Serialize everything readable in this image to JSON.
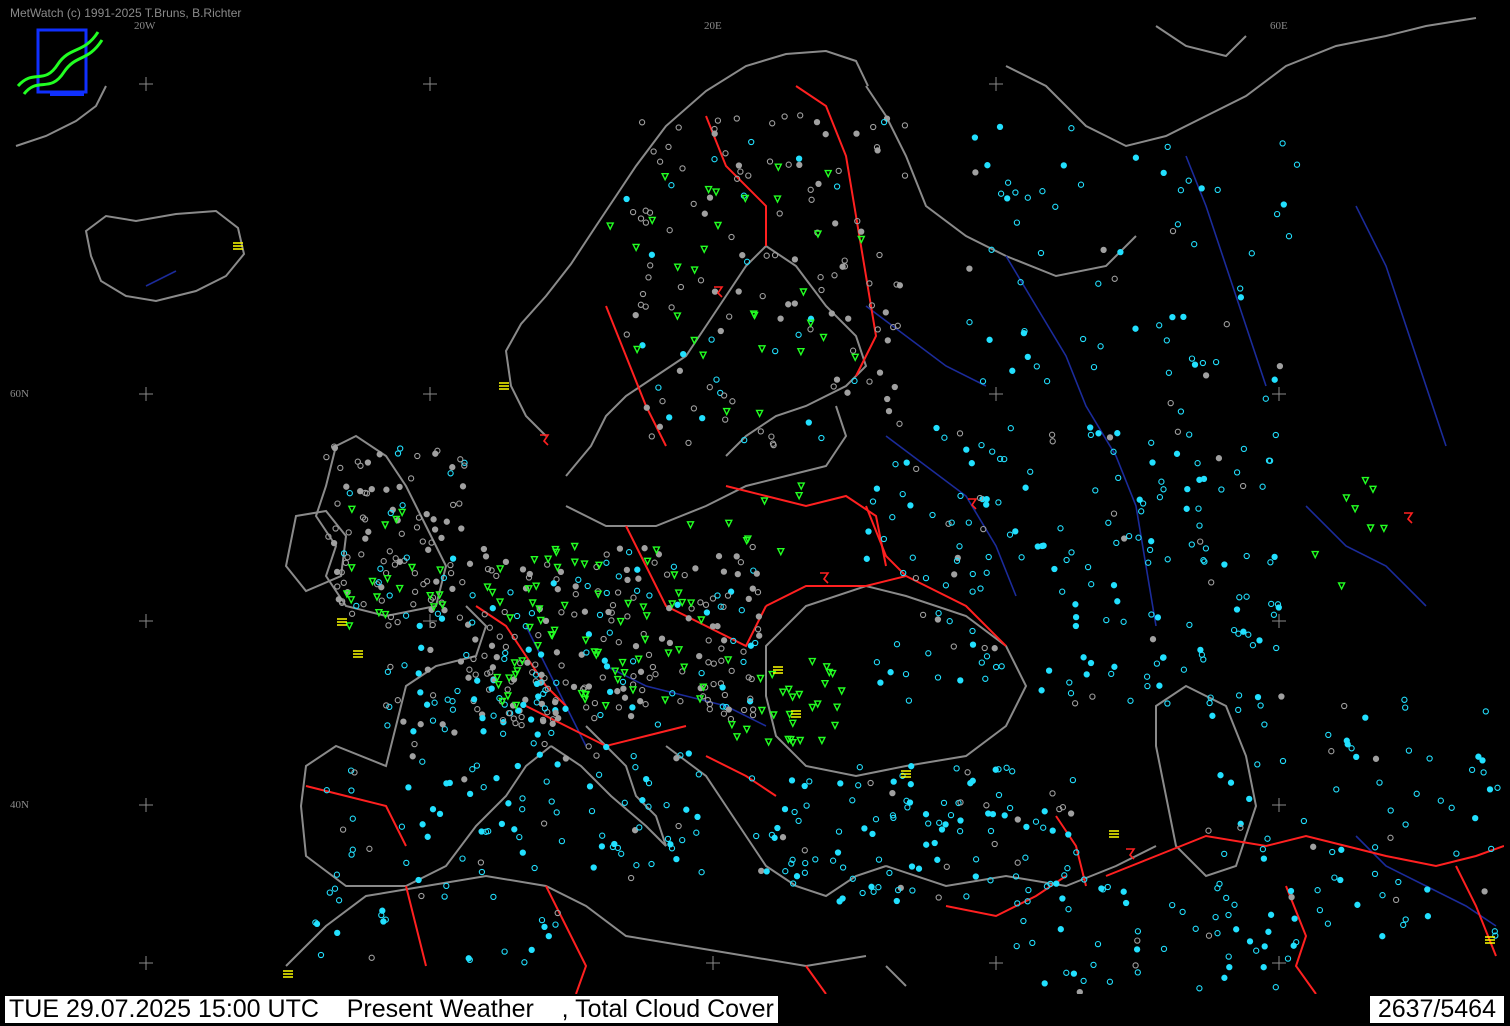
{
  "app": {
    "copyright": "MetWatch  (c) 1991-2025 T.Bruns, B.Richter"
  },
  "grid_labels": {
    "lon_20w": "20W",
    "lon_20e": "20E",
    "lon_60e": "60E",
    "lat_60n": "60N",
    "lat_40n": "40N"
  },
  "status": {
    "datetime": "TUE 29.07.2025 15:00 UTC",
    "layer1": "Present Weather",
    "separator": ",",
    "layer2": "Total Cloud Cover",
    "count": "2637/5464"
  },
  "colors": {
    "background": "#000000",
    "coastline": "#8a8a8a",
    "borders": "#ff2020",
    "rivers": "#1b2b9a",
    "station_cyan": "#22e0ff",
    "station_gray": "#a0a0a0",
    "weather_green": "#22ff22",
    "weather_yellow": "#ffff00",
    "weather_red": "#ff2020"
  },
  "icons": {
    "logo": "metwatch-logo-icon",
    "graticule": "plus-cross-icon",
    "cloud_cover": "circle-icon",
    "rain": "rain-triangle-icon",
    "shower": "shower-icon",
    "fog": "fog-bars-icon",
    "thunder": "thunderstorm-icon"
  }
}
